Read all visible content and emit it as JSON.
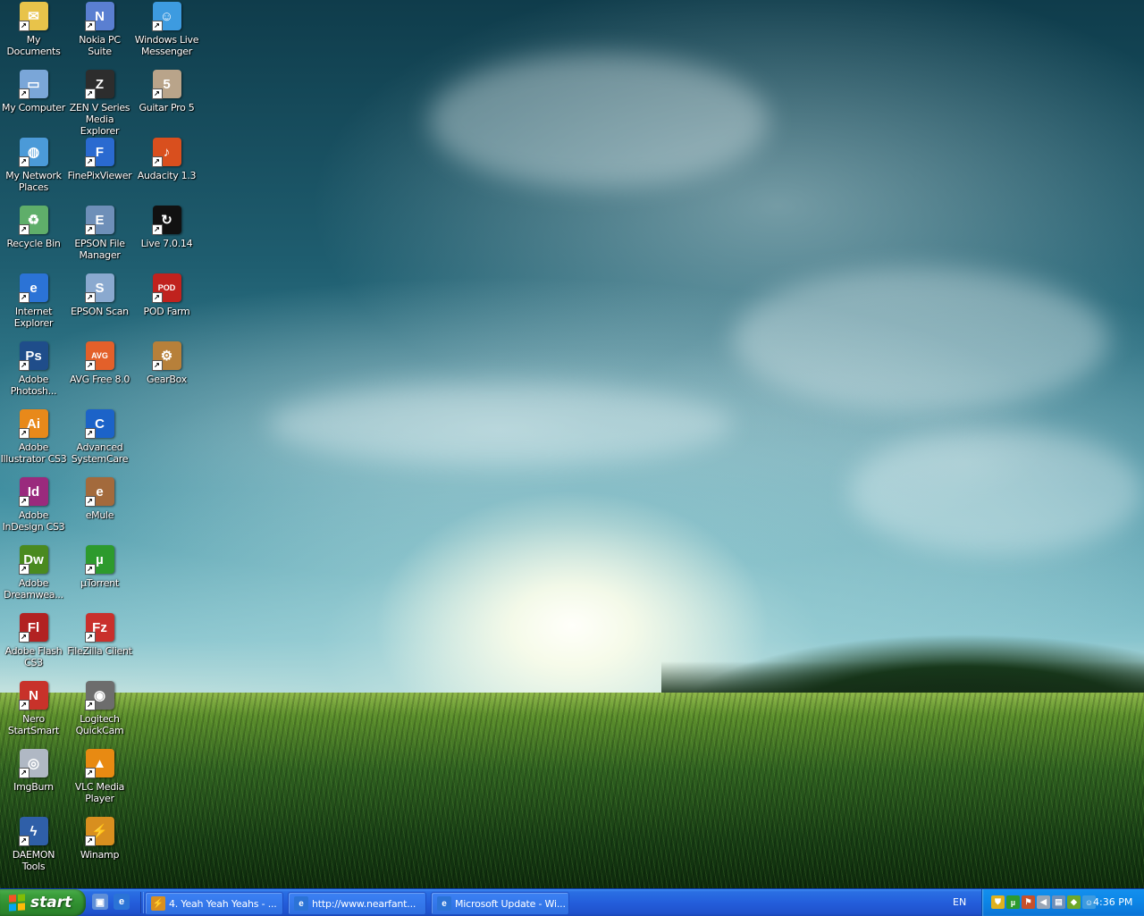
{
  "desktop": {
    "icons": [
      {
        "label": "My Documents",
        "glyph": "✉",
        "color": "#e8c34a"
      },
      {
        "label": "Nokia PC Suite",
        "glyph": "N",
        "color": "#5a7fd1"
      },
      {
        "label": "Windows Live Messenger",
        "glyph": "☺",
        "color": "#3d9be0"
      },
      {
        "label": "My Computer",
        "glyph": "▭",
        "color": "#7aa6d8"
      },
      {
        "label": "ZEN V Series Media Explorer",
        "glyph": "Z",
        "color": "#2d2d2d"
      },
      {
        "label": "Guitar Pro 5",
        "glyph": "5",
        "color": "#b9a48a"
      },
      {
        "label": "My Network Places",
        "glyph": "◍",
        "color": "#4b9ad8"
      },
      {
        "label": "FinePixViewer",
        "glyph": "F",
        "color": "#2a6ad0"
      },
      {
        "label": "Audacity 1.3",
        "glyph": "♪",
        "color": "#d94f1e"
      },
      {
        "label": "Recycle Bin",
        "glyph": "♻",
        "color": "#5fae6a"
      },
      {
        "label": "EPSON File Manager",
        "glyph": "E",
        "color": "#6e8fb8"
      },
      {
        "label": "Live 7.0.14",
        "glyph": "↻",
        "color": "#111111"
      },
      {
        "label": "Internet Explorer",
        "glyph": "e",
        "color": "#2b73d6"
      },
      {
        "label": "EPSON Scan",
        "glyph": "S",
        "color": "#8aa9cf"
      },
      {
        "label": "POD Farm",
        "glyph": "POD",
        "color": "#c0221e"
      },
      {
        "label": "Adobe Photosh...",
        "glyph": "Ps",
        "color": "#1f4d8a"
      },
      {
        "label": "AVG Free 8.0",
        "glyph": "AVG",
        "color": "#e3602a"
      },
      {
        "label": "GearBox",
        "glyph": "⚙",
        "color": "#b7803a"
      },
      {
        "label": "Adobe Illustrator CS3",
        "glyph": "Ai",
        "color": "#e8891a"
      },
      {
        "label": "Advanced SystemCare",
        "glyph": "C",
        "color": "#1c63c8"
      },
      {
        "label": "Adobe InDesign CS3",
        "glyph": "Id",
        "color": "#9a2a7d"
      },
      {
        "label": "eMule",
        "glyph": "e",
        "color": "#a36a3c"
      },
      {
        "label": "Adobe Dreamwea...",
        "glyph": "Dw",
        "color": "#4a8a1f"
      },
      {
        "label": "µTorrent",
        "glyph": "µ",
        "color": "#2d9a2d"
      },
      {
        "label": "Adobe Flash CS3",
        "glyph": "Fl",
        "color": "#b22222"
      },
      {
        "label": "FileZilla Client",
        "glyph": "Fz",
        "color": "#c9302c"
      },
      {
        "label": "Nero StartSmart",
        "glyph": "N",
        "color": "#c8322a"
      },
      {
        "label": "Logitech QuickCam",
        "glyph": "◉",
        "color": "#6d6d6d"
      },
      {
        "label": "ImgBurn",
        "glyph": "◎",
        "color": "#b0b8c4"
      },
      {
        "label": "VLC Media Player",
        "glyph": "▲",
        "color": "#e88a12"
      },
      {
        "label": "DAEMON Tools",
        "glyph": "ϟ",
        "color": "#2f5fa8"
      },
      {
        "label": "Winamp",
        "glyph": "⚡",
        "color": "#d88f1f"
      }
    ]
  },
  "taskbar": {
    "start_label": "start",
    "start_logo_colors": [
      "#f35325",
      "#81bc06",
      "#05a6f0",
      "#ffba08"
    ],
    "quick_launch": [
      {
        "name": "show-desktop",
        "glyph": "▣",
        "color": "#5f8fd8"
      },
      {
        "name": "internet-explorer",
        "glyph": "e",
        "color": "#2b73d6"
      }
    ],
    "tasks": [
      {
        "label": "4. Yeah Yeah Yeahs - ...",
        "glyph": "⚡",
        "color": "#d88f1f"
      },
      {
        "label": "http://www.nearfant...",
        "glyph": "e",
        "color": "#2b73d6"
      },
      {
        "label": "Microsoft Update - Wi...",
        "glyph": "e",
        "color": "#2b73d6"
      }
    ],
    "language": "EN",
    "tray": [
      {
        "name": "security-shield",
        "glyph": "⛊",
        "color": "#e0b11e"
      },
      {
        "name": "utorrent",
        "glyph": "µ",
        "color": "#2d9a2d"
      },
      {
        "name": "windows-flag",
        "glyph": "⚑",
        "color": "#c7502a"
      },
      {
        "name": "volume",
        "glyph": "◀",
        "color": "#9aa6b6"
      },
      {
        "name": "network",
        "glyph": "▤",
        "color": "#6f8fb8"
      },
      {
        "name": "nvidia",
        "glyph": "◆",
        "color": "#6fa82a"
      },
      {
        "name": "messenger",
        "glyph": "☺",
        "color": "#3d9be0"
      }
    ],
    "clock": "4:36 PM"
  }
}
